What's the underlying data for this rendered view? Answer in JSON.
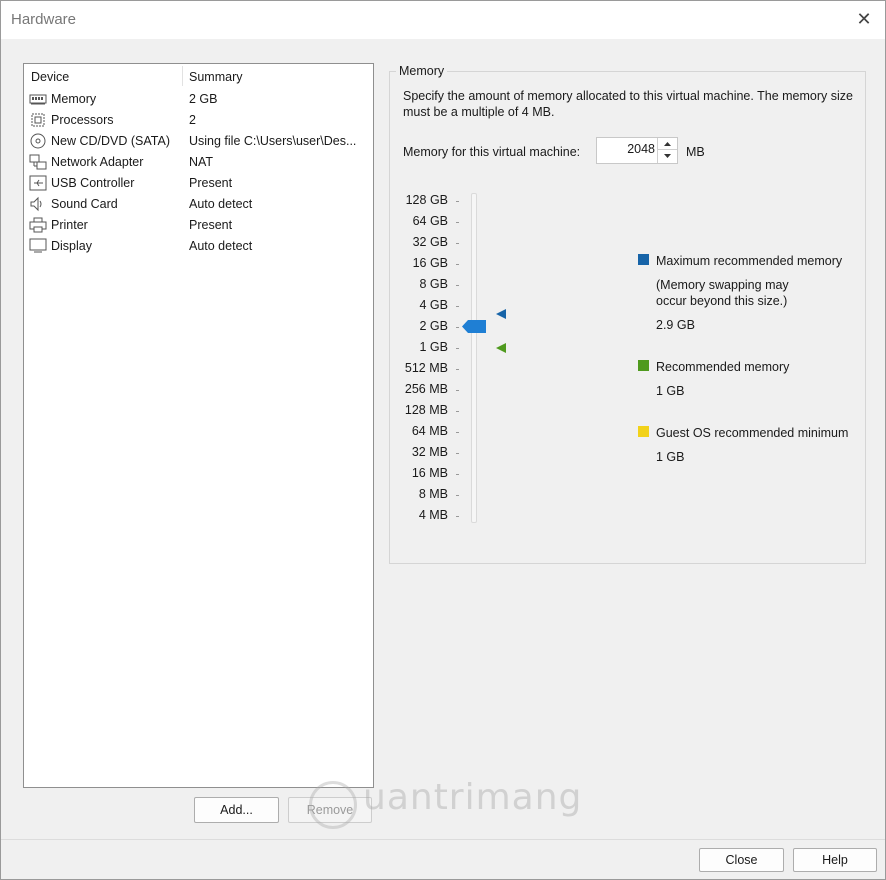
{
  "window": {
    "title": "Hardware"
  },
  "device_list": {
    "headers": {
      "device": "Device",
      "summary": "Summary"
    },
    "rows": [
      {
        "icon": "memory-icon",
        "name": "Memory",
        "summary": "2 GB"
      },
      {
        "icon": "processor-icon",
        "name": "Processors",
        "summary": "2"
      },
      {
        "icon": "cd-dvd-icon",
        "name": "New CD/DVD (SATA)",
        "summary": "Using file C:\\Users\\user\\Des..."
      },
      {
        "icon": "network-adapter-icon",
        "name": "Network Adapter",
        "summary": "NAT"
      },
      {
        "icon": "usb-icon",
        "name": "USB Controller",
        "summary": "Present"
      },
      {
        "icon": "sound-icon",
        "name": "Sound Card",
        "summary": "Auto detect"
      },
      {
        "icon": "printer-icon",
        "name": "Printer",
        "summary": "Present"
      },
      {
        "icon": "display-icon",
        "name": "Display",
        "summary": "Auto detect"
      }
    ],
    "add_label": "Add...",
    "remove_label": "Remove"
  },
  "memory": {
    "group_label": "Memory",
    "description": "Specify the amount of memory allocated to this virtual machine. The memory size must be a multiple of 4 MB.",
    "field_label": "Memory for this virtual machine:",
    "value": "2048",
    "unit": "MB",
    "scale_labels": [
      "128 GB",
      "64 GB",
      "32 GB",
      "16 GB",
      "8 GB",
      "4 GB",
      "2 GB",
      "1 GB",
      "512 MB",
      "256 MB",
      "128 MB",
      "64 MB",
      "32 MB",
      "16 MB",
      "8 MB",
      "4 MB"
    ],
    "slider_value": "2 GB",
    "legend": {
      "max": {
        "label": "Maximum recommended memory",
        "note_line1": "(Memory swapping may",
        "note_line2": "occur beyond this size.)",
        "value": "2.9 GB",
        "color": "#1764a8"
      },
      "recommended": {
        "label": "Recommended memory",
        "value": "1 GB",
        "color": "#4f9a1e"
      },
      "guest_min": {
        "label": "Guest OS recommended minimum",
        "value": "1 GB",
        "color": "#f2d21a"
      }
    }
  },
  "footer": {
    "close_label": "Close",
    "help_label": "Help"
  },
  "watermark": {
    "text": "uantrimang"
  }
}
